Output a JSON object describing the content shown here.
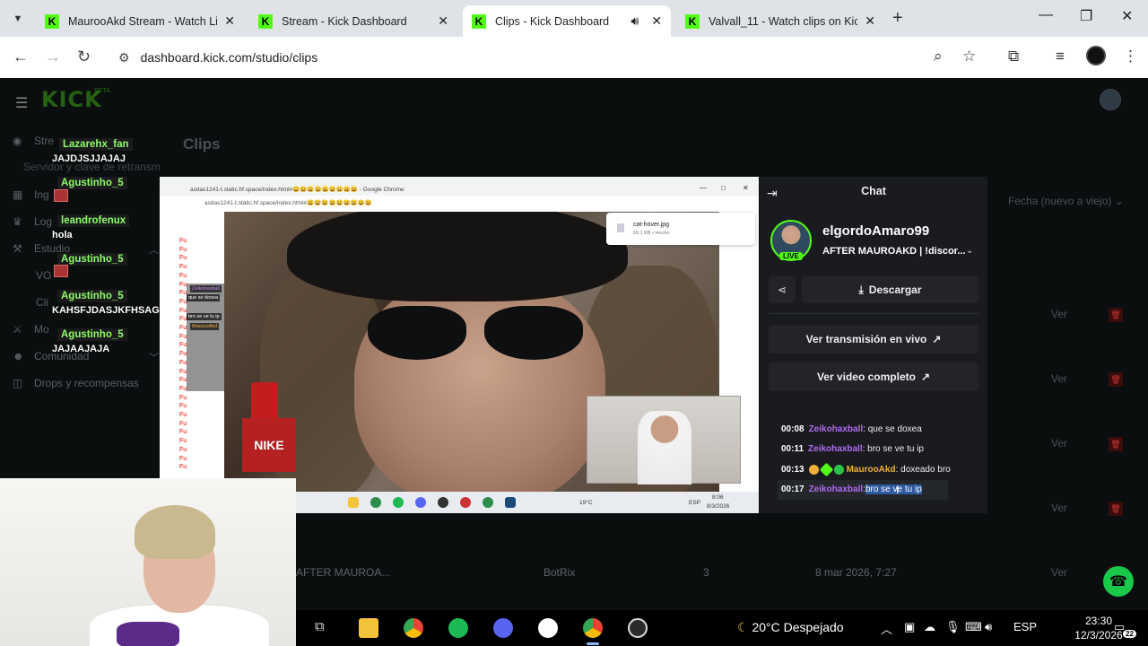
{
  "browser": {
    "tabs": [
      {
        "title": "MaurooAkd Stream - Watch Live"
      },
      {
        "title": "Stream - Kick Dashboard"
      },
      {
        "title": "Clips - Kick Dashboard"
      },
      {
        "title": "Valvall_11 - Watch clips on Kick"
      }
    ],
    "url": "dashboard.kick.com/studio/clips"
  },
  "dashboard": {
    "logo": "KICK",
    "logo_badge": "BETA",
    "page_title": "Clips",
    "sidebar": {
      "items": [
        {
          "label": "Stre",
          "icon": "stream-icon"
        },
        {
          "label": "Servidor y clave de retransm"
        },
        {
          "label": "Ing",
          "icon": "income-icon"
        },
        {
          "label": "Log",
          "icon": "trophy-icon"
        },
        {
          "label": "Estudio",
          "icon": "studio-icon"
        },
        {
          "label": "VO"
        },
        {
          "label": "Cli"
        },
        {
          "label": "Mo",
          "icon": "moderation-icon"
        },
        {
          "label": "Comunidad",
          "icon": "community-icon"
        },
        {
          "label": "Drops y recompensas",
          "icon": "drops-icon"
        }
      ]
    },
    "sort_label": "Fecha (nuevo a viejo)",
    "row_action": "Ver",
    "visible_row": {
      "title": "AFTER MAUROA...",
      "creator": "BotRix",
      "views": "3",
      "date": "8 mar 2026, 7:27"
    }
  },
  "overlay_chat": [
    {
      "user": "Lazarehx_fan",
      "msg": "JAJDJSJJAJAJ"
    },
    {
      "user": "Agustinho_5",
      "msg": ""
    },
    {
      "user": "leandrofenux",
      "msg": "hola"
    },
    {
      "user": "Agustinho_5",
      "msg": ""
    },
    {
      "user": "Agustinho_5",
      "msg": "KAHSFJDASJKFHSAG"
    },
    {
      "user": "Agustinho_5",
      "msg": "JAJAAJAJA"
    }
  ],
  "capture": {
    "window_title": "asdas1241-t.static.hf.space/index.html#😀😀😀😀😀😀😀😀😀 - Google Chrome",
    "url": "asdas1241-t.static.hf.space/index.html#😀😀😀😀😀😀😀😀😀",
    "download_name": "cat-hover.jpg",
    "download_info": "69.1 KB • Hecho",
    "chat_lines": [
      "Zeikohaxball",
      "que se doxea",
      "bro se ve tu ip",
      "MaurooAkd"
    ],
    "shirt_text": "NIKE",
    "weather": "19°C",
    "lang": "ESP",
    "time": "8:06",
    "date": "8/3/2026"
  },
  "chat_panel": {
    "title": "Chat",
    "username": "elgordoAmaro99",
    "live_badge": "LIVE",
    "stream_title": "AFTER MAUROAKD | !discor...",
    "download_label": "Descargar",
    "live_button": "Ver transmisión en vivo",
    "full_video_button": "Ver video completo",
    "messages": [
      {
        "ts": "00:08",
        "user": "Zeikohaxball",
        "text": ": que se doxea"
      },
      {
        "ts": "00:11",
        "user": "Zeikohaxball",
        "text": ": bro se ve tu ip"
      },
      {
        "ts": "00:13",
        "user": "MaurooAkd",
        "text": ": doxeado bro"
      },
      {
        "ts": "00:17",
        "user": "Zeikohaxball",
        "text_plain": ":",
        "text_selected": " bro se ve tu ip"
      }
    ]
  },
  "taskbar": {
    "weather": "20°C  Despejado",
    "lang": "ESP",
    "time": "23:30",
    "date": "12/3/2026",
    "notifications": "22"
  },
  "colors": {
    "kick_green": "#53fc18",
    "chat_purple": "#b06cf0",
    "chat_gold": "#f0b03a"
  }
}
